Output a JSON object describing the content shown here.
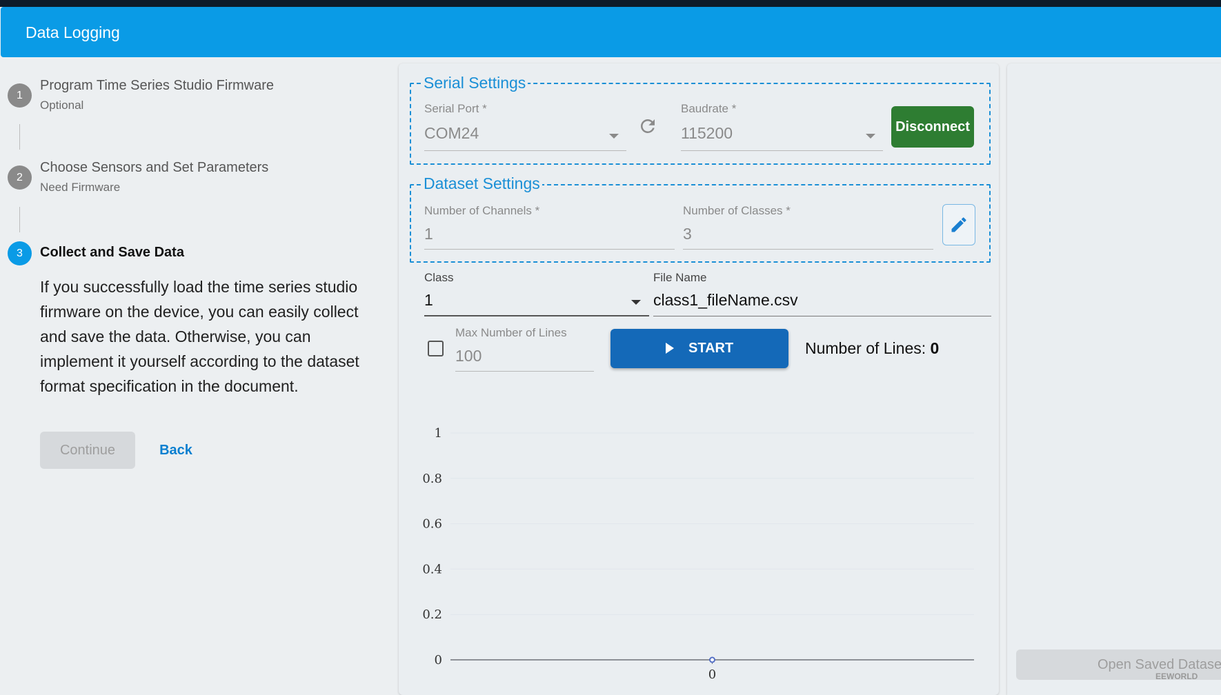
{
  "app": {
    "title": "Data Logging"
  },
  "stepper": {
    "steps": [
      {
        "number": "1",
        "title": "Program Time Series Studio Firmware",
        "subtitle": "Optional"
      },
      {
        "number": "2",
        "title": "Choose Sensors and Set Parameters",
        "subtitle": "Need Firmware"
      },
      {
        "number": "3",
        "title": "Collect and Save Data",
        "description": "If you successfully load the time series studio firmware on the device, you can easily collect and save the data. Otherwise, you can implement it yourself according to the dataset format specification in the document."
      }
    ],
    "continue_label": "Continue",
    "back_label": "Back"
  },
  "serial_settings": {
    "legend": "Serial Settings",
    "port_label": "Serial Port *",
    "port_value": "COM24",
    "baud_label": "Baudrate *",
    "baud_value": "115200",
    "disconnect_label": "Disconnect"
  },
  "dataset_settings": {
    "legend": "Dataset Settings",
    "channels_label": "Number of Channels *",
    "channels_value": "1",
    "classes_label": "Number of Classes *",
    "classes_value": "3"
  },
  "collection": {
    "class_label": "Class",
    "class_value": "1",
    "filename_label": "File Name",
    "filename_value": "class1_fileName.csv",
    "max_lines_label": "Max Number of Lines",
    "max_lines_value": "100",
    "start_label": "START",
    "lines_label": "Number of Lines: ",
    "lines_count": "0"
  },
  "chart_data": {
    "type": "line",
    "x": [
      0
    ],
    "series": [
      {
        "values": [
          0
        ]
      }
    ],
    "yticks": [
      "0",
      "0.2",
      "0.4",
      "0.6",
      "0.8",
      "1"
    ],
    "xticks": [
      "0"
    ],
    "ylim": [
      0,
      1
    ],
    "grid": true,
    "colors": {
      "line": "#5470c6",
      "grid": "#e0e6ec",
      "axis": "#6e7079"
    }
  },
  "right_panel": {
    "open_saved_label": "Open Saved Datase"
  },
  "watermark": "EEWORLD"
}
